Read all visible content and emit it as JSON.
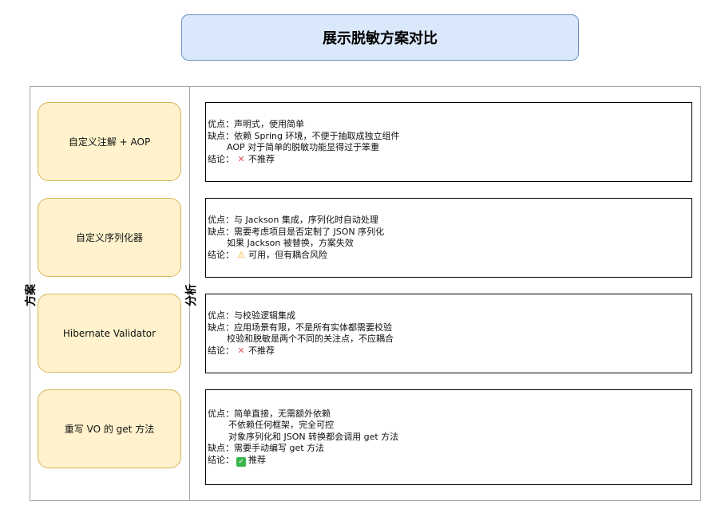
{
  "title": "展示脱敏方案对比",
  "labels": {
    "scheme_column": "方案",
    "analysis_column": "分析"
  },
  "schemes": [
    {
      "label": "自定义注解 + AOP"
    },
    {
      "label": "自定义序列化器"
    },
    {
      "label": "Hibernate Validator"
    },
    {
      "label": "重写 VO 的 get 方法"
    }
  ],
  "analysis": [
    {
      "pros": "优点：声明式，使用简单",
      "cons": "缺点：依赖 Spring 环境，不便于抽取成独立组件",
      "cons_cont": "AOP 对于简单的脱敏功能显得过于笨重",
      "conclusion_prefix": "结论：",
      "conclusion_text": "不推荐",
      "conclusion_icon": "cross-mark-icon"
    },
    {
      "pros": "优点：与 Jackson 集成，序列化时自动处理",
      "cons": "缺点：需要考虑项目是否定制了 JSON 序列化",
      "cons_cont": "如果 Jackson 被替换，方案失效",
      "conclusion_prefix": "结论：",
      "conclusion_text": "可用，但有耦合风险",
      "conclusion_icon": "warning-icon"
    },
    {
      "pros": "优点：与校验逻辑集成",
      "cons": "缺点：应用场景有限，不是所有实体都需要校验",
      "cons_cont": "校验和脱敏是两个不同的关注点，不应耦合",
      "conclusion_prefix": "结论：",
      "conclusion_text": "不推荐",
      "conclusion_icon": "cross-mark-icon"
    },
    {
      "pros": "优点：简单直接，无需额外依赖",
      "pros_cont1": "不依赖任何框架，完全可控",
      "pros_cont2": "对象序列化和 JSON 转换都会调用 get 方法",
      "cons": "缺点：需要手动编写 get 方法",
      "conclusion_prefix": "结论：",
      "conclusion_text": "推荐",
      "conclusion_icon": "check-mark-icon"
    }
  ],
  "colors": {
    "title_fill": "#dae8fc",
    "title_stroke": "#6c8ebf",
    "scheme_fill": "#fff2cc",
    "scheme_stroke": "#d6b656",
    "cross": "#e0536b",
    "warn": "#f2a81d",
    "check": "#3ab54a"
  }
}
